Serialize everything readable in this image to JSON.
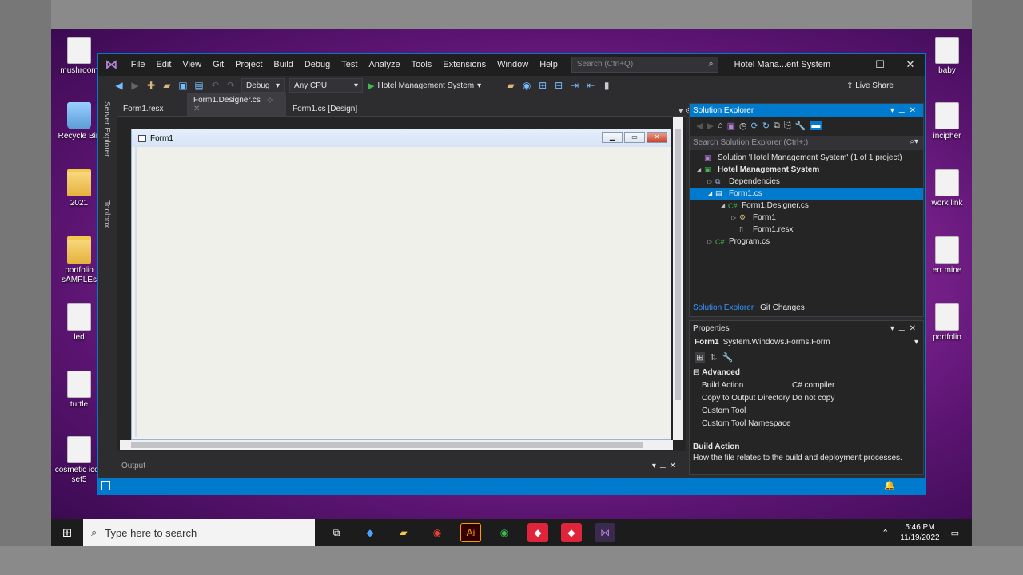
{
  "desktop_icons": [
    {
      "label": "mushroom"
    },
    {
      "label": "Recycle Bin"
    },
    {
      "label": "2021"
    },
    {
      "label": "portfolio sAMPLEs"
    },
    {
      "label": "led"
    },
    {
      "label": "turtle"
    },
    {
      "label": "cosmetic icon set5"
    },
    {
      "label": "baby"
    },
    {
      "label": "incipher"
    },
    {
      "label": "work link"
    },
    {
      "label": "err mine"
    },
    {
      "label": "portfolio"
    }
  ],
  "menu": [
    "File",
    "Edit",
    "View",
    "Git",
    "Project",
    "Build",
    "Debug",
    "Test",
    "Analyze",
    "Tools",
    "Extensions",
    "Window",
    "Help"
  ],
  "search_placeholder": "Search (Ctrl+Q)",
  "window_title": "Hotel Mana...ent System",
  "toolbar": {
    "config": "Debug",
    "platform": "Any CPU",
    "run_target": "Hotel Management System",
    "live_share": "Live Share"
  },
  "side_tabs": [
    "Server Explorer",
    "Toolbox"
  ],
  "doc_tabs": [
    {
      "label": "Form1.resx"
    },
    {
      "label": "Form1.Designer.cs"
    },
    {
      "label": "Form1.cs [Design]"
    }
  ],
  "form": {
    "title": "Form1"
  },
  "output_label": "Output",
  "solution_explorer": {
    "title": "Solution Explorer",
    "search_placeholder": "Search Solution Explorer (Ctrl+;)",
    "tree": [
      {
        "label": "Solution 'Hotel Management System' (1 of 1 project)",
        "icon": "solution-icon"
      },
      {
        "label": "Hotel Management System",
        "icon": "project-icon",
        "bold": true
      },
      {
        "label": "Dependencies",
        "icon": "dependencies-icon"
      },
      {
        "label": "Form1.cs",
        "icon": "form-icon",
        "selected": true
      },
      {
        "label": "Form1.Designer.cs",
        "icon": "csharp-file-icon"
      },
      {
        "label": "Form1",
        "icon": "class-icon"
      },
      {
        "label": "Form1.resx",
        "icon": "resx-file-icon"
      },
      {
        "label": "Program.cs",
        "icon": "csharp-file-icon"
      }
    ],
    "tabs": [
      "Solution Explorer",
      "Git Changes"
    ]
  },
  "properties": {
    "title": "Properties",
    "object_name": "Form1",
    "object_type": "System.Windows.Forms.Form",
    "category": "Advanced",
    "rows": [
      {
        "key": "Build Action",
        "value": "C# compiler"
      },
      {
        "key": "Copy to Output Directory",
        "value": "Do not copy"
      },
      {
        "key": "Custom Tool",
        "value": ""
      },
      {
        "key": "Custom Tool Namespace",
        "value": ""
      }
    ],
    "desc_title": "Build Action",
    "desc_text": "How the file relates to the build and deployment processes."
  },
  "taskbar": {
    "search_placeholder": "Type here to search",
    "time": "5:46 PM",
    "date": "11/19/2022"
  }
}
